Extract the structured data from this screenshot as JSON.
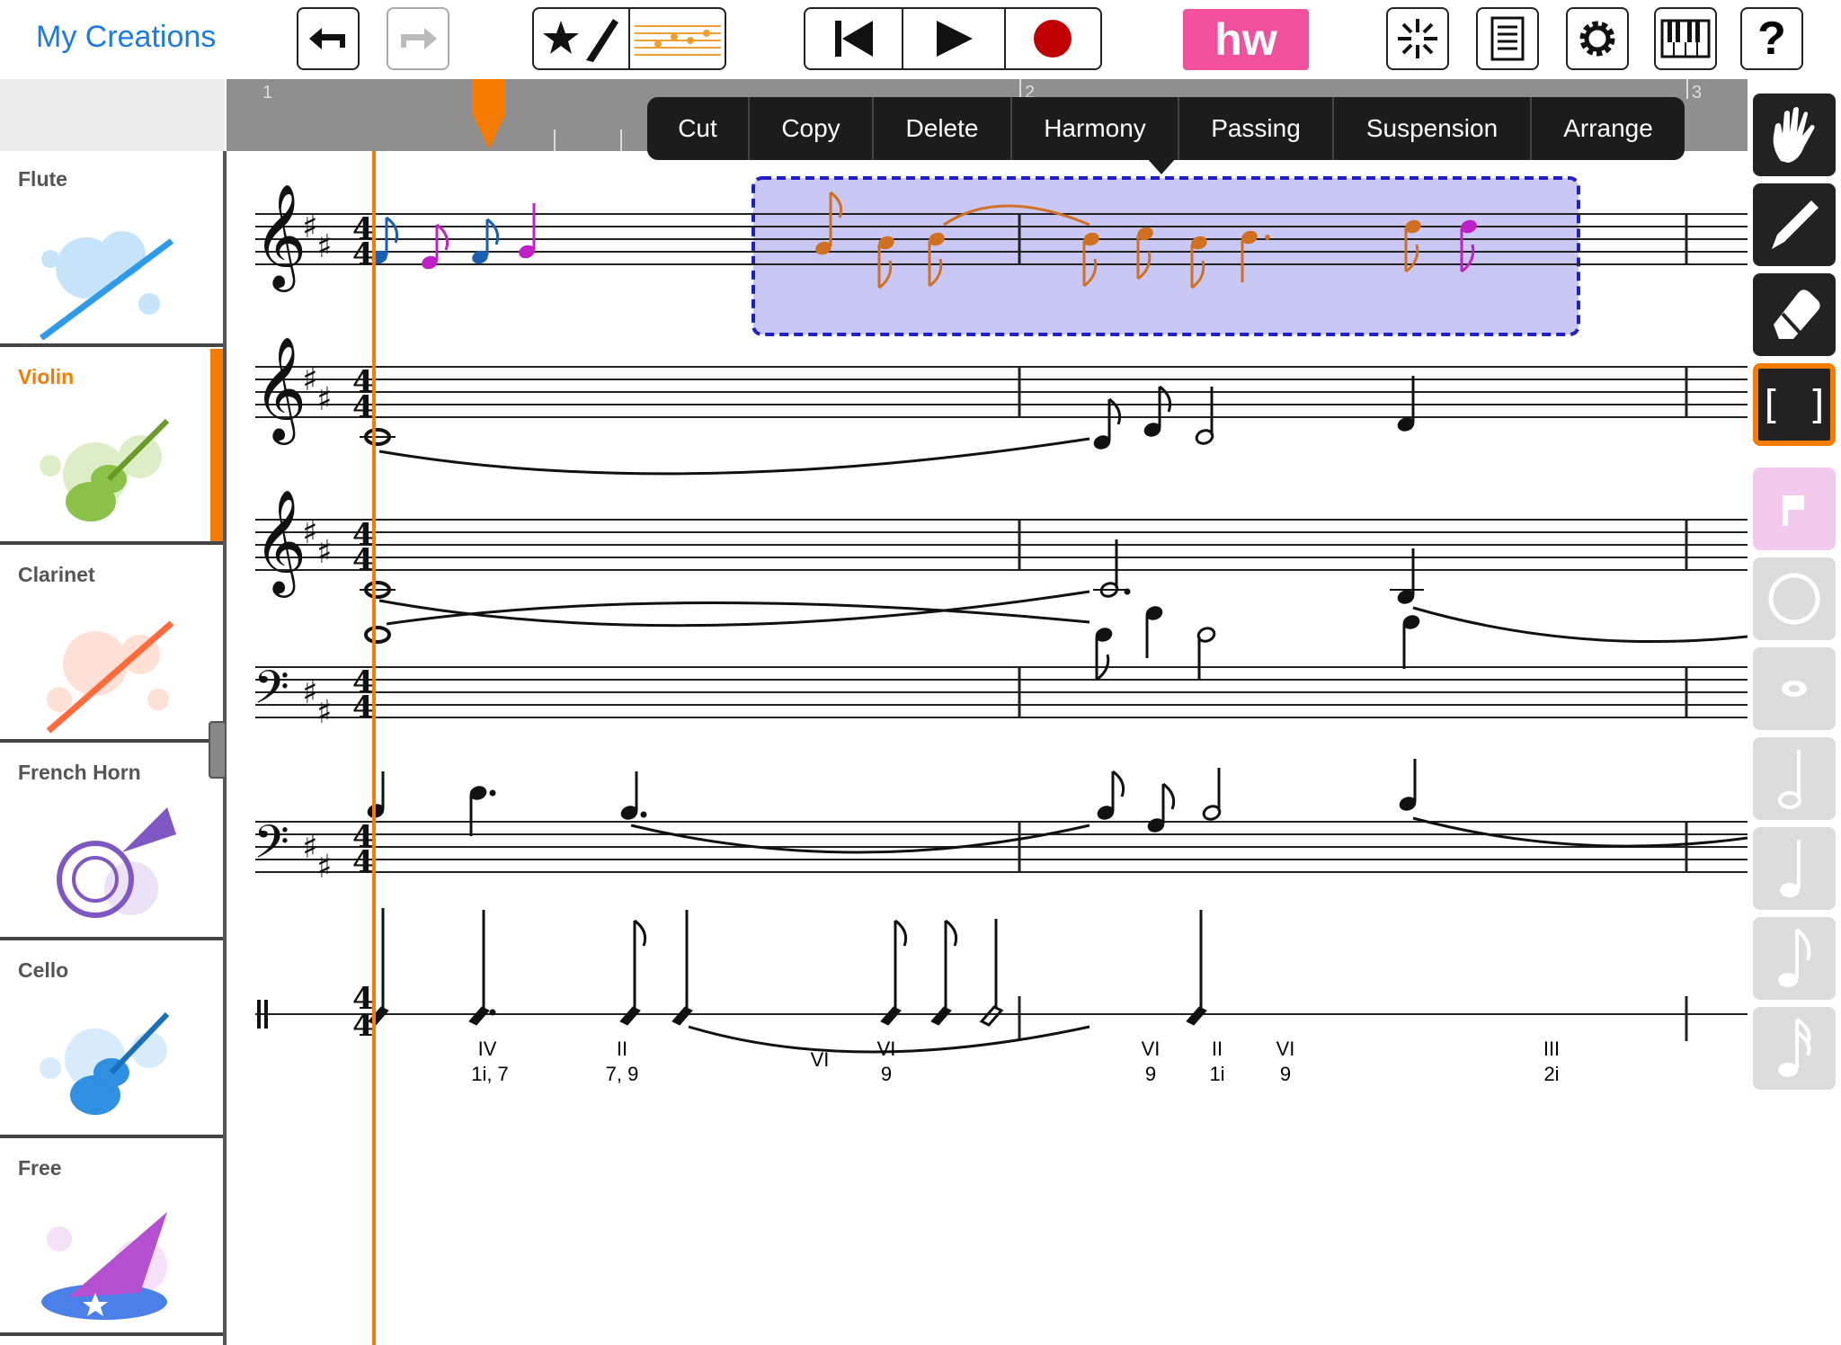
{
  "app": {
    "back_label": "My Creations"
  },
  "toolbar": {
    "undo": "undo-icon",
    "redo": "redo-icon",
    "hw_label": "hw"
  },
  "sidebar": {
    "instruments": [
      {
        "label": "Flute",
        "color": "#2f9be8",
        "active": false
      },
      {
        "label": "Violin",
        "color": "#8bc34a",
        "active": true
      },
      {
        "label": "Clarinet",
        "color": "#ff6b3d",
        "active": false
      },
      {
        "label": "French Horn",
        "color": "#7e57c2",
        "active": false
      },
      {
        "label": "Cello",
        "color": "#2f8fe0",
        "active": false
      },
      {
        "label": "Free",
        "color": "#b44fd0",
        "active": false
      }
    ]
  },
  "ruler": {
    "measures": [
      "1",
      "2",
      "3"
    ]
  },
  "context_menu": {
    "items": [
      "Cut",
      "Copy",
      "Delete",
      "Harmony",
      "Passing",
      "Suspension",
      "Arrange"
    ]
  },
  "score": {
    "time_signature": "4/4",
    "roman_numerals": [
      {
        "top": "IV",
        "bottom": "1i, 7"
      },
      {
        "top": "II",
        "bottom": "7, 9"
      },
      {
        "top": "",
        "bottom": "VI"
      },
      {
        "top": "VI",
        "bottom": "9"
      },
      {
        "top": "VI",
        "bottom": "9"
      },
      {
        "top": "II",
        "bottom": "1i"
      },
      {
        "top": "VI",
        "bottom": "9"
      },
      {
        "top": "III",
        "bottom": "2i"
      }
    ]
  },
  "tools": [
    "hand-icon",
    "pen-icon",
    "eraser-icon",
    "bracket-select-icon",
    "rest-icon",
    "whole-note-icon",
    "whole-note-small-icon",
    "half-note-icon",
    "quarter-note-icon",
    "eighth-note-icon",
    "sixteenth-note-icon"
  ],
  "colors": {
    "accent": "#f57c00",
    "selection": "#c9c8f5",
    "selection_border": "#2020c8",
    "link": "#1a7ae8"
  }
}
